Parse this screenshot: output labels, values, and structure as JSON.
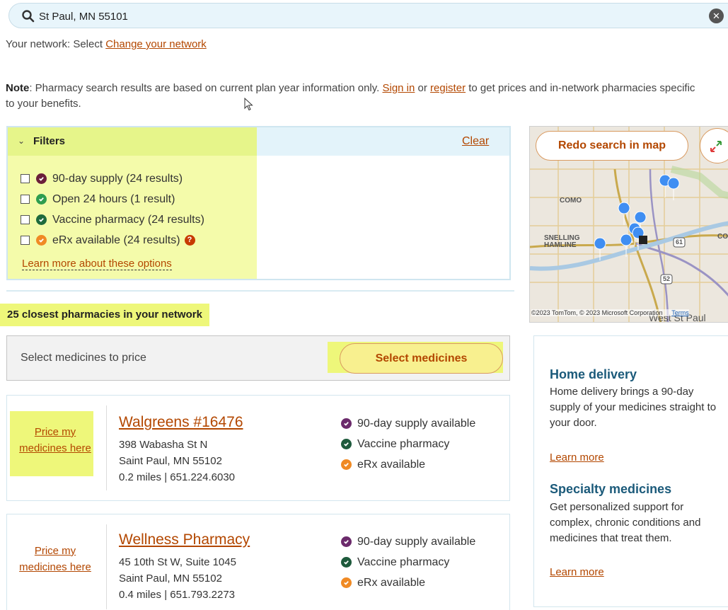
{
  "search": {
    "value": "St Paul, MN 55101"
  },
  "network": {
    "prefix": "Your network: Select",
    "change_link": "Change your network"
  },
  "note": {
    "bold": "Note",
    "text1": ": Pharmacy search results are based on current plan year information only.",
    "sign_in": "Sign in",
    "or": "or",
    "register": "register",
    "text2": "to get prices and in-network pharmacies specific to your benefits."
  },
  "filters": {
    "title": "Filters",
    "clear_label": "Clear",
    "options": [
      {
        "label": "90-day supply (24 results)",
        "color": "#6b1f3a",
        "checked": false
      },
      {
        "label": "Open 24 hours (1 result)",
        "color": "#2e9d4f",
        "checked": false
      },
      {
        "label": "Vaccine pharmacy (24 results)",
        "color": "#1e6b3c",
        "checked": false
      },
      {
        "label": "eRx available (24 results)",
        "color": "#f08a24",
        "checked": false
      }
    ],
    "learn_more": "Learn more about these options"
  },
  "results_heading": "25 closest pharmacies in your network",
  "select_medicines": {
    "label": "Select medicines to price",
    "button": "Select medicines"
  },
  "pharmacies": [
    {
      "price_link": "Price my medicines here",
      "name": "Walgreens #16476",
      "address1": "398 Wabasha St N",
      "address2": "Saint Paul, MN 55102",
      "distance_phone": "0.2 miles | 651.224.6030",
      "features": [
        {
          "label": "90-day supply available",
          "color": "#6b2a6b"
        },
        {
          "label": "Vaccine pharmacy",
          "color": "#1e5a3c"
        },
        {
          "label": "eRx available",
          "color": "#f08a24"
        }
      ]
    },
    {
      "price_link": "Price my medicines here",
      "name": "Wellness Pharmacy",
      "address1": "45 10th St W, Suite 1045",
      "address2": "Saint Paul, MN 55102",
      "distance_phone": "0.4 miles | 651.793.2273",
      "features": [
        {
          "label": "90-day supply available",
          "color": "#6b2a6b"
        },
        {
          "label": "Vaccine pharmacy",
          "color": "#1e5a3c"
        },
        {
          "label": "eRx available",
          "color": "#f08a24"
        }
      ]
    }
  ],
  "map": {
    "redo_button": "Redo search in map",
    "copyright": "©2023 TomTom, © 2023 Microsoft Corporation",
    "terms": "Terms",
    "places": [
      "COMO",
      "SNELLING HAMLINE",
      "CON",
      "West St Paul"
    ],
    "highways": [
      "61",
      "52"
    ]
  },
  "side": {
    "home_title": "Home delivery",
    "home_text": "Home delivery brings a 90-day supply of your medicines straight to your door.",
    "home_link": "Learn more",
    "spec_title": "Specialty medicines",
    "spec_text": "Get personalized support for complex, chronic conditions and medicines that treat them.",
    "spec_link": "Learn more"
  }
}
